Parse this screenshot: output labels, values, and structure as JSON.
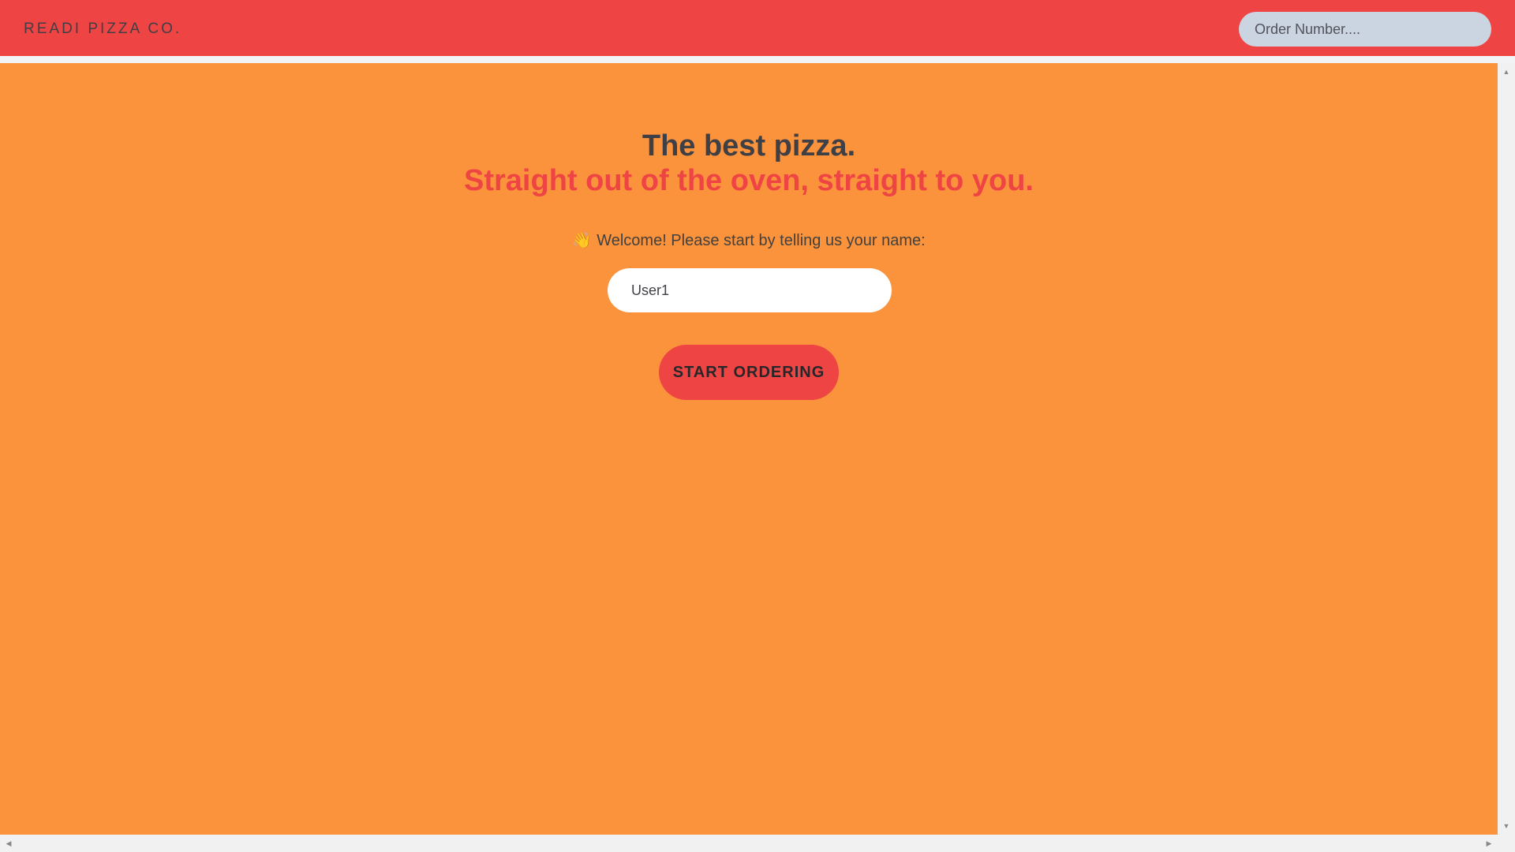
{
  "header": {
    "logo": "READI PIZZA CO.",
    "order_search": {
      "placeholder": "Order Number...."
    }
  },
  "main": {
    "headline": "The best pizza.",
    "tagline": "Straight out of the oven, straight to you.",
    "welcome_icon": "👋",
    "welcome_text": "Welcome! Please start by telling us your name:",
    "name_input": {
      "value": "User1"
    },
    "start_button_label": "START ORDERING"
  },
  "colors": {
    "header_bg": "#ef4444",
    "main_bg": "#fb923c",
    "accent": "#ef4444",
    "text_dark": "#3f3f46",
    "search_bg": "#cbd5e1"
  },
  "scrollbar": {
    "up_icon": "▲",
    "down_icon": "▼",
    "left_icon": "◀",
    "right_icon": "▶"
  }
}
